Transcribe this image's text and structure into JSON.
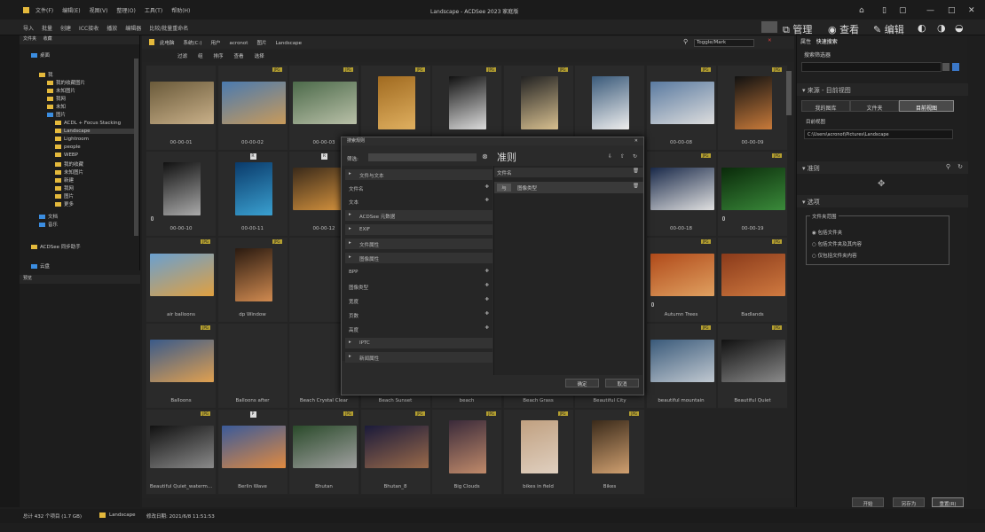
{
  "window": {
    "title": "Landscape - ACDSee 2023 家庭版"
  },
  "menus": [
    "文件(F)",
    "编辑(E)",
    "视图(V)",
    "整理(O)",
    "工具(T)",
    "帮助(H)"
  ],
  "toolbar": [
    "导入",
    "批量",
    "创建",
    "ICC接收",
    "播放",
    "编辑器",
    "比较/批量重命名"
  ],
  "modes": {
    "manage": "管理",
    "view": "查看",
    "edit": "编辑"
  },
  "left_tabs": [
    "文件夹",
    "收藏"
  ],
  "tree": [
    {
      "label": "桌面",
      "indent": 1,
      "blue": true
    },
    {
      "label": "我",
      "indent": 2,
      "blue": false
    },
    {
      "label": "我的收藏图片",
      "indent": 3,
      "blue": false
    },
    {
      "label": "未知图片",
      "indent": 3,
      "blue": false
    },
    {
      "label": "我网",
      "indent": 3,
      "blue": false
    },
    {
      "label": "未知",
      "indent": 3,
      "blue": false
    },
    {
      "label": "图片",
      "indent": 3,
      "blue": true
    },
    {
      "label": "ACDL + Focus Stacking",
      "indent": 4,
      "blue": false
    },
    {
      "label": "Landscape",
      "indent": 4,
      "blue": false
    },
    {
      "label": "Lightroom",
      "indent": 4,
      "blue": false
    },
    {
      "label": "people",
      "indent": 4,
      "blue": false
    },
    {
      "label": "WEBP",
      "indent": 4,
      "blue": false
    },
    {
      "label": "我的收藏",
      "indent": 4,
      "blue": false
    },
    {
      "label": "未知图片",
      "indent": 4,
      "blue": false
    },
    {
      "label": "新建",
      "indent": 4,
      "blue": false
    },
    {
      "label": "我网",
      "indent": 4,
      "blue": false
    },
    {
      "label": "图片",
      "indent": 4,
      "blue": false
    },
    {
      "label": "更多",
      "indent": 4,
      "blue": false
    },
    {
      "label": "文档",
      "indent": 2,
      "blue": true
    },
    {
      "label": "音乐",
      "indent": 2,
      "blue": true
    },
    {
      "label": "ACDSee 同步助手",
      "indent": 1,
      "blue": false
    },
    {
      "label": "云盘",
      "indent": 1,
      "blue": true
    }
  ],
  "preview_tab": "预览",
  "path": {
    "crumbs": [
      "此电脑",
      "系统(C:)",
      "用户",
      "acronot",
      "图片",
      "Landscape"
    ],
    "search": "Toggle/Mark"
  },
  "filters": [
    "过滤",
    "组",
    "排序",
    "查看",
    "选择"
  ],
  "thumbs": [
    {
      "cap": "00-00-01",
      "badge": "",
      "mark": "",
      "c1": "#6a5a3a",
      "c2": "#c9b089"
    },
    {
      "cap": "00-00-02",
      "badge": "JPG",
      "mark": "",
      "c1": "#4a7ab0",
      "c2": "#c89a5a"
    },
    {
      "cap": "00-00-03",
      "badge": "JPG",
      "mark": "",
      "c1": "#4c6a4a",
      "c2": "#b9c0a8"
    },
    {
      "cap": "00-00-04",
      "badge": "JPG",
      "mark": "",
      "c1": "#a06a20",
      "c2": "#e0b060"
    },
    {
      "cap": "00-00-05",
      "badge": "JPG",
      "mark": "",
      "c1": "#111",
      "c2": "#ddd"
    },
    {
      "cap": "00-00-06",
      "badge": "JPG",
      "mark": "",
      "c1": "#222",
      "c2": "#d8c090"
    },
    {
      "cap": "00-00-07",
      "badge": "",
      "mark": "",
      "c1": "#3a5a7a",
      "c2": "#eee"
    },
    {
      "cap": "00-00-08",
      "badge": "JPG",
      "mark": "",
      "c1": "#5a7aa0",
      "c2": "#ddd"
    },
    {
      "cap": "00-00-09",
      "badge": "JPG",
      "mark": "",
      "c1": "#111",
      "c2": "#c87a3a"
    },
    {
      "cap": "00-00-10",
      "badge": "",
      "mark": "",
      "c1": "#111",
      "c2": "#aaa"
    },
    {
      "cap": "00-00-11",
      "badge": "",
      "mark": "R",
      "c1": "#0a3a6a",
      "c2": "#3aa0d0"
    },
    {
      "cap": "00-00-12",
      "badge": "",
      "mark": "R",
      "c1": "#3a2a1a",
      "c2": "#e09a40"
    },
    {
      "cap": "",
      "badge": "",
      "mark": "",
      "c1": "#2a2a2a",
      "c2": "#2a2a2a"
    },
    {
      "cap": "",
      "badge": "",
      "mark": "",
      "c1": "#2a2a2a",
      "c2": "#2a2a2a"
    },
    {
      "cap": "",
      "badge": "",
      "mark": "",
      "c1": "#2a2a2a",
      "c2": "#2a2a2a"
    },
    {
      "cap": "00-00-17",
      "badge": "JPG",
      "mark": "",
      "c1": "#111",
      "c2": "#6a5a4a"
    },
    {
      "cap": "00-00-18",
      "badge": "JPG",
      "mark": "",
      "c1": "#1a2a4a",
      "c2": "#e0e0e0"
    },
    {
      "cap": "00-00-19",
      "badge": "JPG",
      "mark": "",
      "c1": "#0a2a0a",
      "c2": "#3a8a3a"
    },
    {
      "cap": "air balloons",
      "badge": "JPG",
      "mark": "",
      "c1": "#6aa0d0",
      "c2": "#e0a040"
    },
    {
      "cap": "dp Window",
      "badge": "JPG",
      "mark": "",
      "c1": "#2a1a10",
      "c2": "#d08a50"
    },
    {
      "cap": "",
      "badge": "",
      "mark": "",
      "c1": "#2a2a2a",
      "c2": "#2a2a2a"
    },
    {
      "cap": "",
      "badge": "",
      "mark": "",
      "c1": "#2a2a2a",
      "c2": "#2a2a2a"
    },
    {
      "cap": "",
      "badge": "",
      "mark": "",
      "c1": "#2a2a2a",
      "c2": "#2a2a2a"
    },
    {
      "cap": "Archway",
      "badge": "JPG",
      "mark": "",
      "c1": "#2a3a5a",
      "c2": "#8aa0c0"
    },
    {
      "cap": "Aurora Borealis",
      "badge": "",
      "mark": "R",
      "c1": "#0a1a3a",
      "c2": "#6a4ab0"
    },
    {
      "cap": "Autumn Trees",
      "badge": "JPG",
      "mark": "",
      "c1": "#b04a1a",
      "c2": "#e0a060"
    },
    {
      "cap": "Badlands",
      "badge": "JPG",
      "mark": "",
      "c1": "#8a3a1a",
      "c2": "#d07a40"
    },
    {
      "cap": "Balloons",
      "badge": "JPG",
      "mark": "",
      "c1": "#3a5a8a",
      "c2": "#e0a050"
    },
    {
      "cap": "Balloons after",
      "badge": "",
      "mark": "",
      "c1": "#2a2a2a",
      "c2": "#2a2a2a"
    },
    {
      "cap": "Beach Crystal Clear",
      "badge": "",
      "mark": "",
      "c1": "#2a2a2a",
      "c2": "#2a2a2a"
    },
    {
      "cap": "Beach Sunset",
      "badge": "",
      "mark": "",
      "c1": "#2a2a2a",
      "c2": "#2a2a2a"
    },
    {
      "cap": "beach",
      "badge": "",
      "mark": "",
      "c1": "#2a2a2a",
      "c2": "#2a2a2a"
    },
    {
      "cap": "Beach Grass",
      "badge": "",
      "mark": "R",
      "c1": "#8a6a3a",
      "c2": "#e0c080"
    },
    {
      "cap": "Beautiful City",
      "badge": "JPG",
      "mark": "",
      "c1": "#3a4a6a",
      "c2": "#e0a050"
    },
    {
      "cap": "beautiful mountain",
      "badge": "JPG",
      "mark": "",
      "c1": "#3a5a7a",
      "c2": "#c0c8d0"
    },
    {
      "cap": "Beautiful Quiet",
      "badge": "JPG",
      "mark": "",
      "c1": "#111",
      "c2": "#8a8a8a"
    },
    {
      "cap": "Beautiful Quiet_waterm...",
      "badge": "JPG",
      "mark": "",
      "c1": "#111",
      "c2": "#8a8a8a"
    },
    {
      "cap": "Berlin Wave",
      "badge": "",
      "mark": "P",
      "c1": "#3a5a9a",
      "c2": "#e08a40"
    },
    {
      "cap": "Bhutan",
      "badge": "JPG",
      "mark": "",
      "c1": "#2a4a2a",
      "c2": "#a0a0a0"
    },
    {
      "cap": "Bhutan_8",
      "badge": "JPG",
      "mark": "",
      "c1": "#1a1a3a",
      "c2": "#9a6a4a"
    },
    {
      "cap": "Big Clouds",
      "badge": "JPG",
      "mark": "",
      "c1": "#3a2a3a",
      "c2": "#c08a6a"
    },
    {
      "cap": "bikes in field",
      "badge": "JPG",
      "mark": "",
      "c1": "#c0a080",
      "c2": "#e0d0c0"
    },
    {
      "cap": "Bikes",
      "badge": "JPG",
      "mark": "",
      "c1": "#3a2a1a",
      "c2": "#d0a070"
    }
  ],
  "dialog": {
    "title": "搜索规则",
    "filter_label": "筛选:",
    "rules_heading": "准则",
    "left_items": [
      {
        "label": "文件与文本",
        "head": true,
        "plus": false
      },
      {
        "label": "文件名",
        "head": false,
        "plus": true
      },
      {
        "label": "文本",
        "head": false,
        "plus": true
      },
      {
        "label": "ACDSee 元数据",
        "head": true,
        "plus": false
      },
      {
        "label": "EXIF",
        "head": true,
        "plus": false
      },
      {
        "label": "文件属性",
        "head": true,
        "plus": false
      },
      {
        "label": "图像属性",
        "head": true,
        "plus": false
      },
      {
        "label": "BPP",
        "head": false,
        "plus": true
      },
      {
        "label": "图像类型",
        "head": false,
        "plus": true
      },
      {
        "label": "宽度",
        "head": false,
        "plus": true
      },
      {
        "label": "页数",
        "head": false,
        "plus": true
      },
      {
        "label": "高度",
        "head": false,
        "plus": true
      },
      {
        "label": "IPTC",
        "head": true,
        "plus": false
      },
      {
        "label": "新闻属性",
        "head": true,
        "plus": false
      }
    ],
    "right_header": "文件名",
    "rule_tag": "与",
    "rule_label": "图像类型",
    "ok": "确定",
    "cancel": "取消"
  },
  "right": {
    "tabs": [
      "属性",
      "快速搜索"
    ],
    "saved_label": "搜索筛选器",
    "source_title": "来源 - 目前视图",
    "source_tabs": [
      "我的图库",
      "文件夹",
      "目前视图"
    ],
    "path_label": "目前视图",
    "path_value": "C:\\Users\\acronot\\Pictures\\Landscape",
    "rules_title": "准则",
    "options_title": "选项",
    "folder_group": "文件夹范围",
    "radios": [
      "包括文件夹",
      "包括文件夹及其内容",
      "仅包括文件夹内容"
    ],
    "buttons": [
      "开始",
      "另存为",
      "重置(R)"
    ]
  },
  "status": {
    "count": "总计 432 个项目 (1.7 GB)",
    "folder": "Landscape",
    "date": "修改日期: 2021/6/8 11:51:53"
  }
}
